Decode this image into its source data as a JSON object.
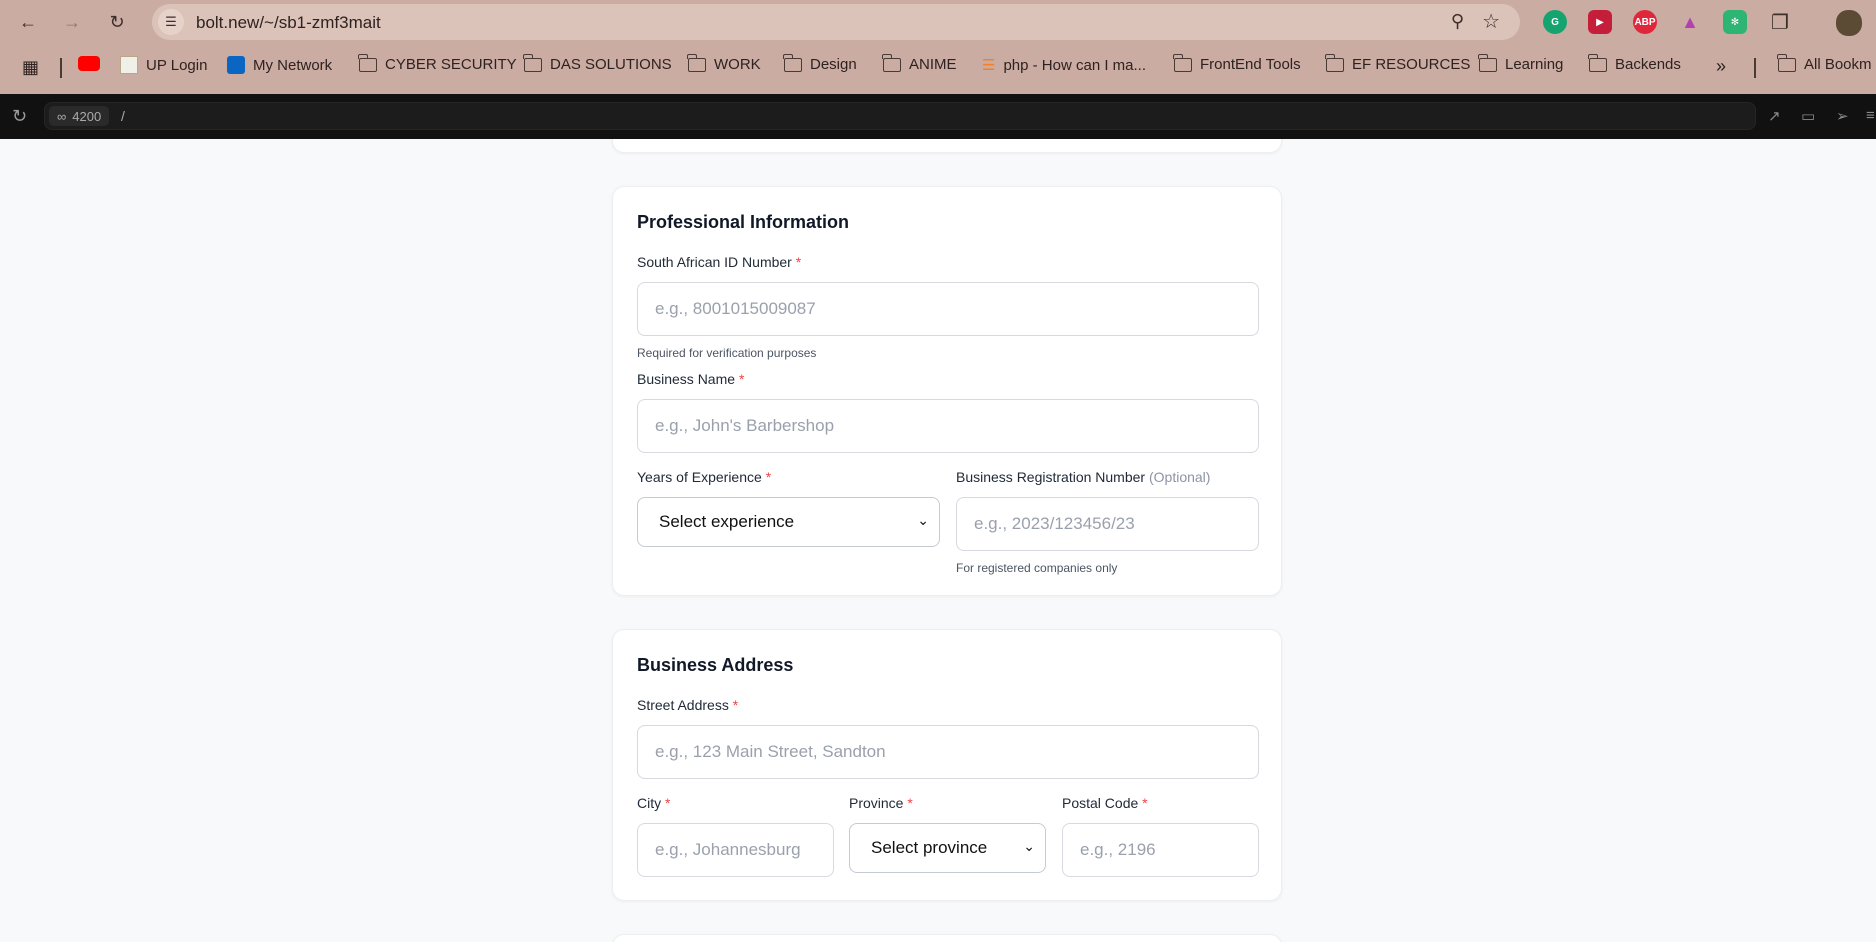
{
  "browser": {
    "url": "bolt.new/~/sb1-zmf3mait",
    "bookmarks": [
      {
        "label": "UP Login"
      },
      {
        "label": "My Network"
      },
      {
        "label": "CYBER SECURITY"
      },
      {
        "label": "DAS SOLUTIONS"
      },
      {
        "label": "WORK"
      },
      {
        "label": "Design"
      },
      {
        "label": "ANIME"
      },
      {
        "label": "php - How can I ma..."
      },
      {
        "label": "FrontEnd Tools"
      },
      {
        "label": "EF RESOURCES"
      },
      {
        "label": "Learning"
      },
      {
        "label": "Backends"
      },
      {
        "label": "All Bookm"
      }
    ],
    "ext_abp": "ABP"
  },
  "devbar": {
    "port": "4200",
    "path": "/"
  },
  "professional": {
    "title": "Professional Information",
    "id_label": "South African ID Number",
    "id_placeholder": "e.g., 8001015009087",
    "id_help": "Required for verification purposes",
    "business_label": "Business Name",
    "business_placeholder": "e.g., John's Barbershop",
    "experience_label": "Years of Experience",
    "experience_value": "Select experience",
    "reg_label": "Business Registration Number",
    "reg_optional": "(Optional)",
    "reg_placeholder": "e.g., 2023/123456/23",
    "reg_help": "For registered companies only"
  },
  "address": {
    "title": "Business Address",
    "street_label": "Street Address",
    "street_placeholder": "e.g., 123 Main Street, Sandton",
    "city_label": "City",
    "city_placeholder": "e.g., Johannesburg",
    "province_label": "Province",
    "province_value": "Select province",
    "postal_label": "Postal Code",
    "postal_placeholder": "e.g., 2196"
  },
  "required_marker": "*",
  "colors": {
    "chrome": "#caaca2",
    "omnibox": "#dcc3ba",
    "required": "#ef4444",
    "page_bg": "#f8f9fb"
  }
}
